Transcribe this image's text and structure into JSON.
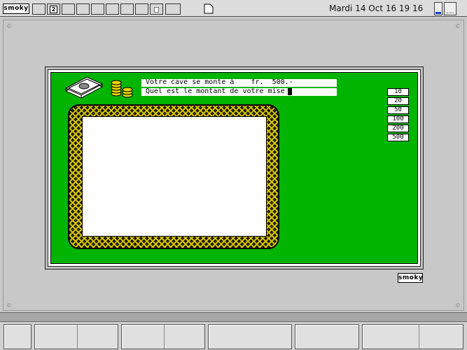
{
  "taskbar_top": {
    "logo": "smoky",
    "workspace_active": "2",
    "clock": "Mardi 14 Oct  16 19 16"
  },
  "game": {
    "cave_line": "Votre cave se monte à    fr.  500.-",
    "mise_line": "Quel est le montant de votre mise",
    "bets": [
      "10",
      "20",
      "50",
      "100",
      "200",
      "500"
    ],
    "logo": "smoky"
  },
  "colors": {
    "felt": "#00b400",
    "desktop": "#c8c8c8",
    "border_gold": "#d4c000"
  },
  "icons": {
    "money": "banknotes-icon",
    "coins": "coin-stack-icon",
    "document": "document-icon"
  }
}
